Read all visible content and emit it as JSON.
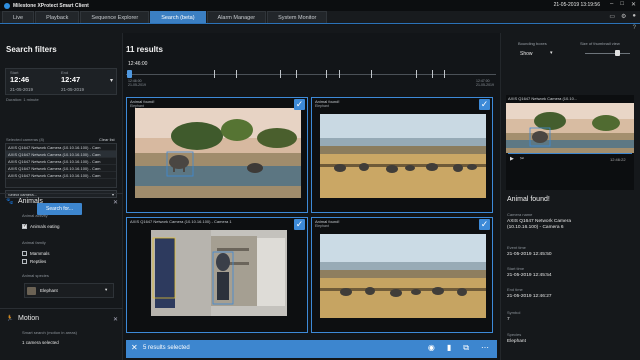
{
  "titlebar": {
    "title": "Milestone XProtect Smart Client",
    "clock": "21-05-2019 13:19:56"
  },
  "tabs": [
    {
      "label": "Live"
    },
    {
      "label": "Playback"
    },
    {
      "label": "Sequence Explorer"
    },
    {
      "label": "Search (beta)",
      "active": true
    },
    {
      "label": "Alarm Manager"
    },
    {
      "label": "System Monitor"
    }
  ],
  "filters": {
    "title": "Search filters",
    "start_label": "Start",
    "start_time": "12:46",
    "start_date": "21-05-2019",
    "end_label": "End",
    "end_time": "12:47",
    "end_date": "21-05-2019",
    "duration": "Duration: 1 minute",
    "selected_cameras_label": "Selected cameras (8)",
    "clear_list": "Clear list",
    "cameras": [
      "AXIS Q1647 Network Camera (10.10.16.100) - Cam",
      "AXIS Q1647 Network Camera (10.10.16.100) - Cam",
      "AXIS Q1647 Network Camera (10.10.16.100) - Cam",
      "AXIS Q1647 Network Camera (10.10.16.100) - Cam",
      "AXIS Q1647 Network Camera (10.10.16.100) - Cam"
    ],
    "select_camera": "Select camera...",
    "search_button": "Search for...",
    "animals_title": "Animals",
    "animal_activity_label": "Animal activity",
    "animals_eating": "Animals eating",
    "animal_family_label": "Animal family",
    "mammals": "Mammals",
    "reptiles": "Reptiles",
    "animal_species_label": "Animal species",
    "species_value": "Elephant",
    "motion_title": "Motion",
    "motion_label": "Smart search (motion in areas)",
    "motion_value": "1 camera selected"
  },
  "results": {
    "title": "11 results",
    "timeline_time": "12:46:00",
    "tl_start_a": "12:46:00",
    "tl_start_b": "21-05-2019",
    "tl_end_a": "12:47:00",
    "tl_end_b": "21-05-2019",
    "bounding_label": "Bounding boxes",
    "bounding_value": "Show",
    "thumb_size_label": "Size of thumbnail view",
    "tiles": [
      {
        "cap": "Animal found!",
        "cap2": "Elephant"
      },
      {
        "cap": "Animal found!",
        "cap2": "Elephant"
      },
      {
        "cap": "AXIS Q1647 Network Camera (10.10.16.100) - Camera 1",
        "cap2": ""
      },
      {
        "cap": "Animal found!",
        "cap2": "Elephant"
      }
    ],
    "selected_text": "5 results selected"
  },
  "detail": {
    "preview_caption": "AXIS Q1647 Network Camera (10.10...",
    "preview_time": "12:46:22",
    "heading": "Animal found!",
    "props": [
      {
        "label": "Camera name",
        "value": "AXIS Q1647 Network Camera (10.10.16.100) - Camera 6"
      },
      {
        "label": "Event time",
        "value": "21-05-2019 12:45:50"
      },
      {
        "label": "Start time",
        "value": "21-05-2019 12:45:54"
      },
      {
        "label": "End time",
        "value": "21-05-2019 12:46:27"
      },
      {
        "label": "Symbol",
        "value": "7"
      },
      {
        "label": "Species",
        "value": "Elephant"
      }
    ]
  }
}
